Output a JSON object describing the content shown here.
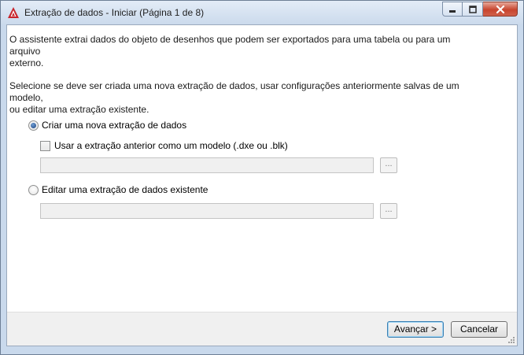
{
  "window": {
    "title": "Extração de dados - Iniciar (Página 1 de 8)"
  },
  "intro": {
    "line1": "O assistente extrai dados do objeto de desenhos que podem ser exportados para uma tabela ou para um arquivo",
    "line2": "externo.",
    "select_line1": "Selecione se deve ser criada uma nova extração de dados, usar configurações anteriormente salvas de um modelo,",
    "select_line2": "ou editar uma extração existente."
  },
  "options": {
    "new_extraction": {
      "label": "Criar uma nova extração de dados",
      "selected": true
    },
    "use_template": {
      "label": "Usar a extração anterior como um modelo (.dxe ou .blk)",
      "checked": false
    },
    "template_path": {
      "value": ""
    },
    "edit_extraction": {
      "label": "Editar uma extração de dados existente",
      "selected": false
    },
    "edit_path": {
      "value": ""
    },
    "browse_label": "..."
  },
  "footer": {
    "next_label": "Avançar >",
    "cancel_label": "Cancelar"
  },
  "colors": {
    "app_icon": "#c8242b",
    "close_button": "#c7452e",
    "radio_dot": "#1b3f7a"
  }
}
